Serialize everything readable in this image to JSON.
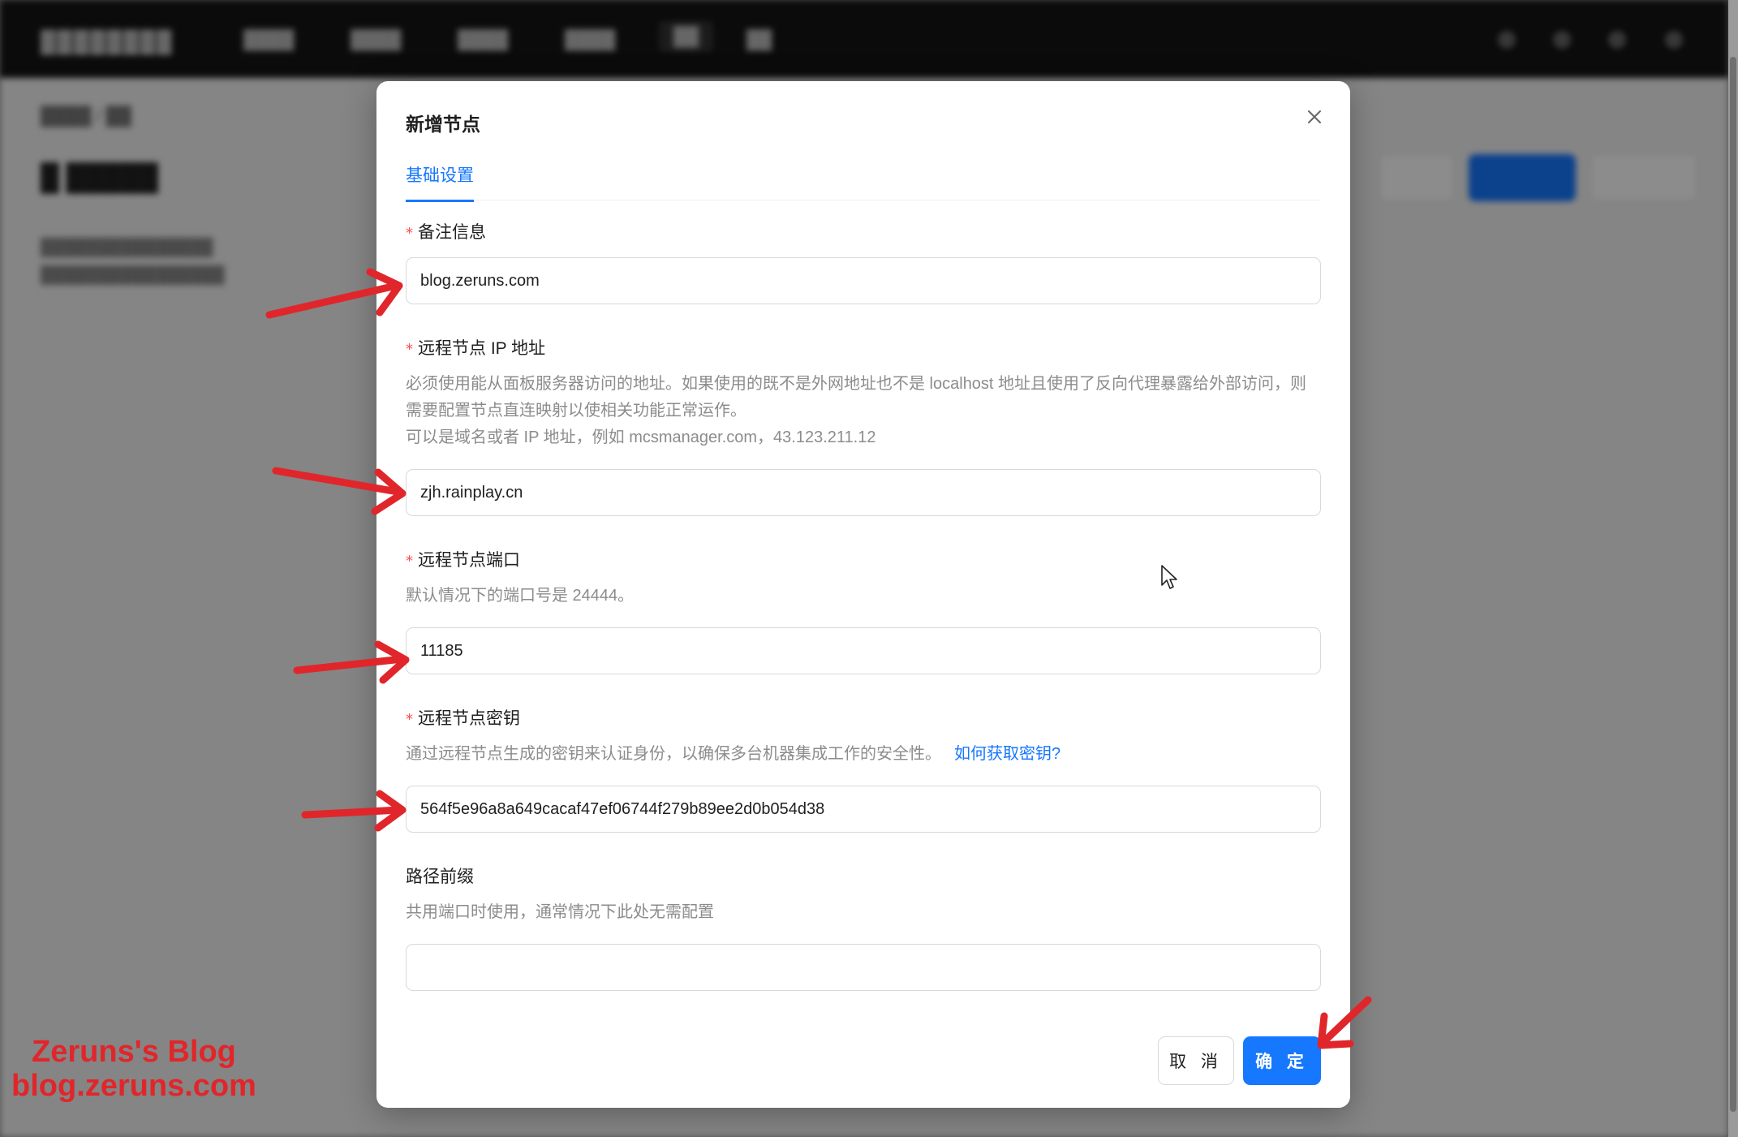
{
  "modal": {
    "title": "新增节点",
    "tab": "基础设置",
    "fields": [
      {
        "label": "备注信息",
        "required": true,
        "help": "",
        "value": "blog.zeruns.com",
        "placeholder": ""
      },
      {
        "label": "远程节点 IP 地址",
        "required": true,
        "help": "必须使用能从面板服务器访问的地址。如果使用的既不是外网地址也不是 localhost 地址且使用了反向代理暴露给外部访问，则需要配置节点直连映射以使相关功能正常运作。",
        "help2": "可以是域名或者 IP 地址，例如 mcsmanager.com，43.123.211.12",
        "value": "zjh.rainplay.cn",
        "placeholder": ""
      },
      {
        "label": "远程节点端口",
        "required": true,
        "help": "默认情况下的端口号是 24444。",
        "value": "11185",
        "placeholder": ""
      },
      {
        "label": "远程节点密钥",
        "required": true,
        "help": "通过远程节点生成的密钥来认证身份，以确保多台机器集成工作的安全性。",
        "help_link": "如何获取密钥?",
        "value": "564f5e96a8a649cacaf47ef06744f279b89ee2d0b054d38",
        "placeholder": ""
      },
      {
        "label": "路径前缀",
        "required": false,
        "help": "共用端口时使用，通常情况下此处无需配置",
        "value": "",
        "placeholder": ""
      }
    ],
    "cancel_label": "取 消",
    "ok_label": "确 定"
  },
  "watermark": {
    "line1": "Zeruns's Blog",
    "line2": "blog.zeruns.com"
  },
  "colors": {
    "primary": "#1677ff",
    "required": "#ff4d4f",
    "annotation": "#e0262b"
  },
  "icons": {
    "close": "close-icon",
    "cursor": "mouse-pointer-icon"
  }
}
